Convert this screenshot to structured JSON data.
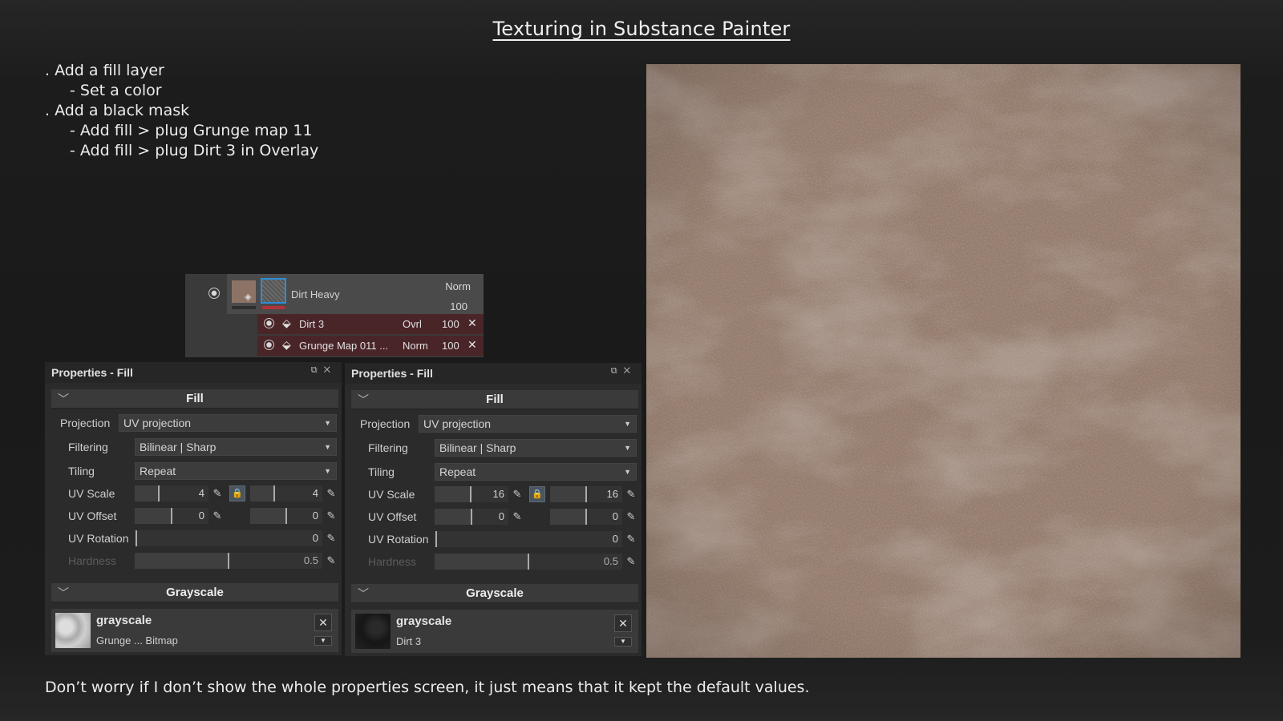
{
  "title": "Texturing in Substance Painter",
  "notes": [
    {
      "text": ". Add a fill layer",
      "indent": false
    },
    {
      "text": "- Set a color",
      "indent": true
    },
    {
      "text": ". Add a black mask",
      "indent": false
    },
    {
      "text": "- Add fill > plug Grunge map 11",
      "indent": true
    },
    {
      "text": "- Add fill > plug Dirt 3 in Overlay",
      "indent": true
    }
  ],
  "footer": "Don’t worry if I don’t show the whole properties screen, it just means that it kept the default values.",
  "layer_stack": {
    "layer": {
      "name": "Dirt Heavy",
      "blend": "Norm",
      "opacity": "100",
      "color": "#8d7366"
    },
    "effects": [
      {
        "name": "Dirt 3",
        "blend": "Ovrl",
        "opacity": "100"
      },
      {
        "name": "Grunge Map 011 ...",
        "blend": "Norm",
        "opacity": "100"
      }
    ]
  },
  "panels": [
    {
      "title": "Properties - Fill",
      "fill_section": "Fill",
      "projection_label": "Projection",
      "projection_value": "UV projection",
      "filtering_label": "Filtering",
      "filtering_value": "Bilinear | Sharp",
      "tiling_label": "Tiling",
      "tiling_value": "Repeat",
      "uv_scale_label": "UV Scale",
      "uv_scale_u": "4",
      "uv_scale_v": "4",
      "uv_offset_label": "UV Offset",
      "uv_offset_u": "0",
      "uv_offset_v": "0",
      "uv_rotation_label": "UV Rotation",
      "uv_rotation": "0",
      "hardness_label": "Hardness",
      "hardness": "0.5",
      "grayscale_section": "Grayscale",
      "resource_name": "grayscale",
      "resource_source": "Grunge ... Bitmap"
    },
    {
      "title": "Properties - Fill",
      "fill_section": "Fill",
      "projection_label": "Projection",
      "projection_value": "UV projection",
      "filtering_label": "Filtering",
      "filtering_value": "Bilinear | Sharp",
      "tiling_label": "Tiling",
      "tiling_value": "Repeat",
      "uv_scale_label": "UV Scale",
      "uv_scale_u": "16",
      "uv_scale_v": "16",
      "uv_offset_label": "UV Offset",
      "uv_offset_u": "0",
      "uv_offset_v": "0",
      "uv_rotation_label": "UV Rotation",
      "uv_rotation": "0",
      "hardness_label": "Hardness",
      "hardness": "0.5",
      "grayscale_section": "Grayscale",
      "resource_name": "grayscale",
      "resource_source": "Dirt 3"
    }
  ],
  "icons": {
    "eye": "eye-icon",
    "fill_bucket": "fill-bucket-icon",
    "remove": "close-icon",
    "edit": "pencil-icon",
    "lock": "lock-icon",
    "collapse": "chevron-down-icon",
    "dropdown": "caret-down-icon"
  },
  "colors": {
    "texture_base": "#8a7263",
    "effect_row": "#4a2528",
    "mask_highlight": "#2a8fd8",
    "mask_bar": "#b0333c"
  }
}
